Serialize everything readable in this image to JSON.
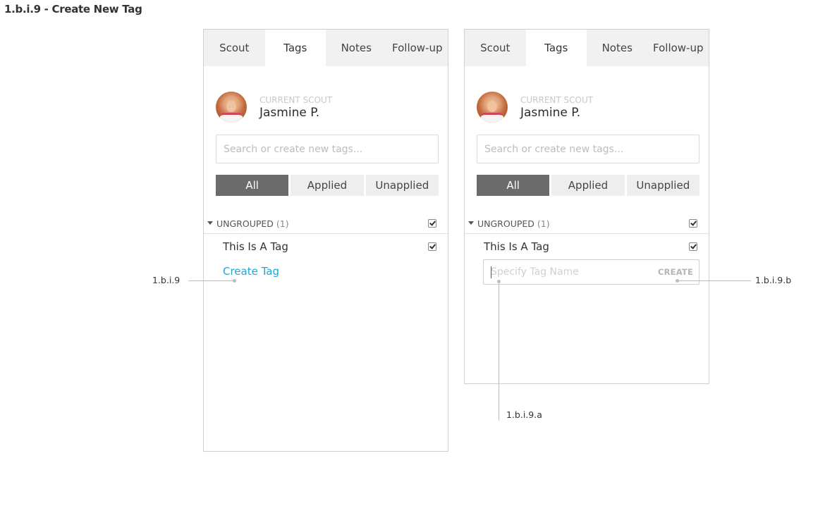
{
  "page": {
    "title": "1.b.i.9 - Create New Tag"
  },
  "tabs": [
    {
      "label": "Scout"
    },
    {
      "label": "Tags"
    },
    {
      "label": "Notes"
    },
    {
      "label": "Follow-up"
    }
  ],
  "active_tab": "Tags",
  "scout": {
    "label": "CURRENT SCOUT",
    "name": "Jasmine P."
  },
  "search": {
    "placeholder": "Search or create new tags..."
  },
  "filters": [
    {
      "label": "All"
    },
    {
      "label": "Applied"
    },
    {
      "label": "Unapplied"
    }
  ],
  "active_filter": "All",
  "group": {
    "label": "UNGROUPED",
    "count": "(1)"
  },
  "tag": {
    "label": "This Is A Tag"
  },
  "create_link": "Create Tag",
  "tag_input": {
    "placeholder": "Specify Tag Name",
    "create_label": "CREATE"
  },
  "annotations": {
    "left": "1.b.i.9",
    "input": "1.b.i.9.a",
    "button": "1.b.i.9.b"
  },
  "colors": {
    "link": "#1aa9d6",
    "active_filter": "#6b6b6b",
    "tab_bg": "#f1f1f1"
  },
  "icons": [
    "caret-down-icon",
    "checkbox-checked-icon"
  ]
}
